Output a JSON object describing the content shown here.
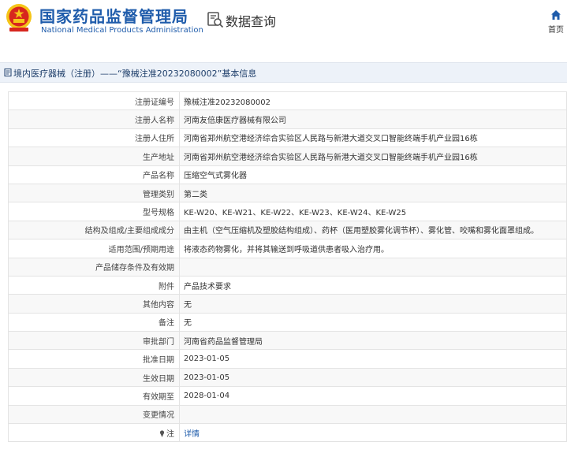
{
  "site": {
    "name_cn": "国家药品监督管理局",
    "name_en": "National Medical Products Administration"
  },
  "header": {
    "query_title": "数据查询",
    "home_label": "首页"
  },
  "breadcrumb": {
    "text": "境内医疗器械（注册）——“豫械注准20232080002”基本信息"
  },
  "rows": [
    {
      "label": "注册证编号",
      "value": "豫械注准20232080002"
    },
    {
      "label": "注册人名称",
      "value": "河南友倍康医疗器械有限公司"
    },
    {
      "label": "注册人住所",
      "value": "河南省郑州航空港经济综合实验区人民路与新港大道交叉口智能终端手机产业园16栋"
    },
    {
      "label": "生产地址",
      "value": "河南省郑州航空港经济综合实验区人民路与新港大道交叉口智能终端手机产业园16栋"
    },
    {
      "label": "产品名称",
      "value": "压缩空气式雾化器"
    },
    {
      "label": "管理类别",
      "value": "第二类"
    },
    {
      "label": "型号规格",
      "value": "KE-W20、KE-W21、KE-W22、KE-W23、KE-W24、KE-W25"
    },
    {
      "label": "结构及组成/主要组成成分",
      "value": "由主机（空气压缩机及塑胶结构组成）、药杯（医用塑胶雾化调节杯）、雾化管、咬嘴和雾化面罩组成。"
    },
    {
      "label": "适用范围/预期用途",
      "value": "将液态药物雾化，并将其输送到呼吸道供患者吸入治疗用。"
    },
    {
      "label": "产品储存条件及有效期",
      "value": ""
    },
    {
      "label": "附件",
      "value": "产品技术要求"
    },
    {
      "label": "其他内容",
      "value": "无"
    },
    {
      "label": "备注",
      "value": "无"
    },
    {
      "label": "审批部门",
      "value": "河南省药品监督管理局"
    },
    {
      "label": "批准日期",
      "value": "2023-01-05"
    },
    {
      "label": "生效日期",
      "value": "2023-01-05"
    },
    {
      "label": "有效期至",
      "value": "2028-01-04"
    },
    {
      "label": "变更情况",
      "value": ""
    }
  ],
  "note_row": {
    "label": "注",
    "link": "详情"
  },
  "colors": {
    "brand_blue": "#1f5cab",
    "emblem_red": "#d7261e",
    "emblem_gold": "#f5c518",
    "breadcrumb_bg": "#edf2f9"
  },
  "icons": {
    "emblem": "national-emblem-icon",
    "query": "data-query-icon",
    "home": "home-icon",
    "breadcrumb": "document-icon",
    "note": "pin-icon"
  }
}
